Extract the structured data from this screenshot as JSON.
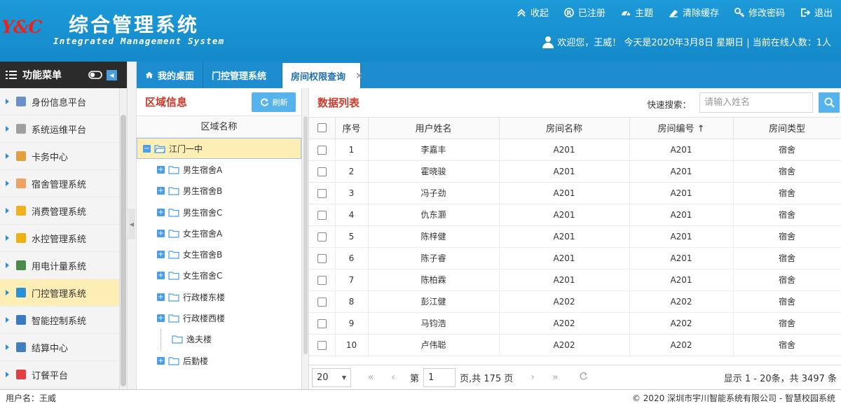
{
  "header": {
    "logo_text": "Y&C",
    "title_cn": "综合管理系统",
    "title_en": "Integrated Management System",
    "links": [
      {
        "icon": "chevron-up-double-icon",
        "label": "收起"
      },
      {
        "icon": "registered-icon",
        "label": "已注册"
      },
      {
        "icon": "dashboard-icon",
        "label": "主题"
      },
      {
        "icon": "eraser-icon",
        "label": "清除缓存"
      },
      {
        "icon": "key-icon",
        "label": "修改密码"
      },
      {
        "icon": "logout-icon",
        "label": "退出"
      }
    ],
    "welcome": "欢迎您，王威！ 今天是2020年3月8日 星期日 | 当前在线人数：1人"
  },
  "menu": {
    "title": "功能菜单",
    "items": [
      {
        "label": "身份信息平台",
        "color": "#6b8fc8",
        "active": false
      },
      {
        "label": "系统运维平台",
        "color": "#a0a0a0",
        "active": false
      },
      {
        "label": "卡务中心",
        "color": "#e0a040",
        "active": false
      },
      {
        "label": "宿舍管理系统",
        "color": "#f0a060",
        "active": false
      },
      {
        "label": "消费管理系统",
        "color": "#f0b020",
        "active": false
      },
      {
        "label": "水控管理系统",
        "color": "#f0b010",
        "active": false
      },
      {
        "label": "用电计量系统",
        "color": "#4a8a4a",
        "active": false
      },
      {
        "label": "门控管理系统",
        "color": "#2a90d8",
        "active": true
      },
      {
        "label": "智能控制系统",
        "color": "#3a7ac0",
        "active": false
      },
      {
        "label": "结算中心",
        "color": "#4080c0",
        "active": false
      },
      {
        "label": "订餐平台",
        "color": "#e04040",
        "active": false
      }
    ]
  },
  "tabs": [
    {
      "label": "我的桌面",
      "icon": "home-icon",
      "active": false
    },
    {
      "label": "门控管理系统",
      "active": false
    },
    {
      "label": "房间权限查询",
      "active": true,
      "close": "×"
    }
  ],
  "left_panel": {
    "title": "区域信息",
    "refresh_label": "刷新",
    "column": "区域名称",
    "tree": [
      {
        "label": "江门一中",
        "level": 0,
        "expander": "−",
        "selected": true
      },
      {
        "label": "男生宿舍A",
        "level": 1,
        "expander": "+"
      },
      {
        "label": "男生宿舍B",
        "level": 1,
        "expander": "+"
      },
      {
        "label": "男生宿舍C",
        "level": 1,
        "expander": "+"
      },
      {
        "label": "女生宿舍A",
        "level": 1,
        "expander": "+"
      },
      {
        "label": "女生宿舍B",
        "level": 1,
        "expander": "+"
      },
      {
        "label": "女生宿舍C",
        "level": 1,
        "expander": "+"
      },
      {
        "label": "行政楼东楼",
        "level": 1,
        "expander": "+"
      },
      {
        "label": "行政楼西楼",
        "level": 1,
        "expander": "+"
      },
      {
        "label": "逸夫楼",
        "level": 1,
        "expander": ""
      },
      {
        "label": "后勤楼",
        "level": 1,
        "expander": "+"
      }
    ]
  },
  "right_panel": {
    "title": "数据列表",
    "search_label": "快速搜索：",
    "search_placeholder": "请输入姓名",
    "columns": [
      "序号",
      "用户姓名",
      "房间名称",
      "房间编号 ↑",
      "房间类型"
    ],
    "rows": [
      [
        "1",
        "李嘉丰",
        "A201",
        "A201",
        "宿舍"
      ],
      [
        "2",
        "霍晓骏",
        "A201",
        "A201",
        "宿舍"
      ],
      [
        "3",
        "冯子劲",
        "A201",
        "A201",
        "宿舍"
      ],
      [
        "4",
        "仇东灏",
        "A201",
        "A201",
        "宿舍"
      ],
      [
        "5",
        "陈梓健",
        "A201",
        "A201",
        "宿舍"
      ],
      [
        "6",
        "陈子睿",
        "A201",
        "A201",
        "宿舍"
      ],
      [
        "7",
        "陈柏霖",
        "A201",
        "A201",
        "宿舍"
      ],
      [
        "8",
        "彭江健",
        "A202",
        "A202",
        "宿舍"
      ],
      [
        "9",
        "马钧浩",
        "A202",
        "A202",
        "宿舍"
      ],
      [
        "10",
        "卢伟聪",
        "A202",
        "A202",
        "宿舍"
      ]
    ]
  },
  "pager": {
    "page_size": "20",
    "page_label": "第",
    "current_page": "1",
    "total_label": "页,共 175 页",
    "info": "显示 1 - 20条，共 3497 条"
  },
  "footer": {
    "user": "用户名：王威",
    "copyright": "© 2020 深圳市宇川智能系统有限公司 - 智慧校园系统"
  }
}
